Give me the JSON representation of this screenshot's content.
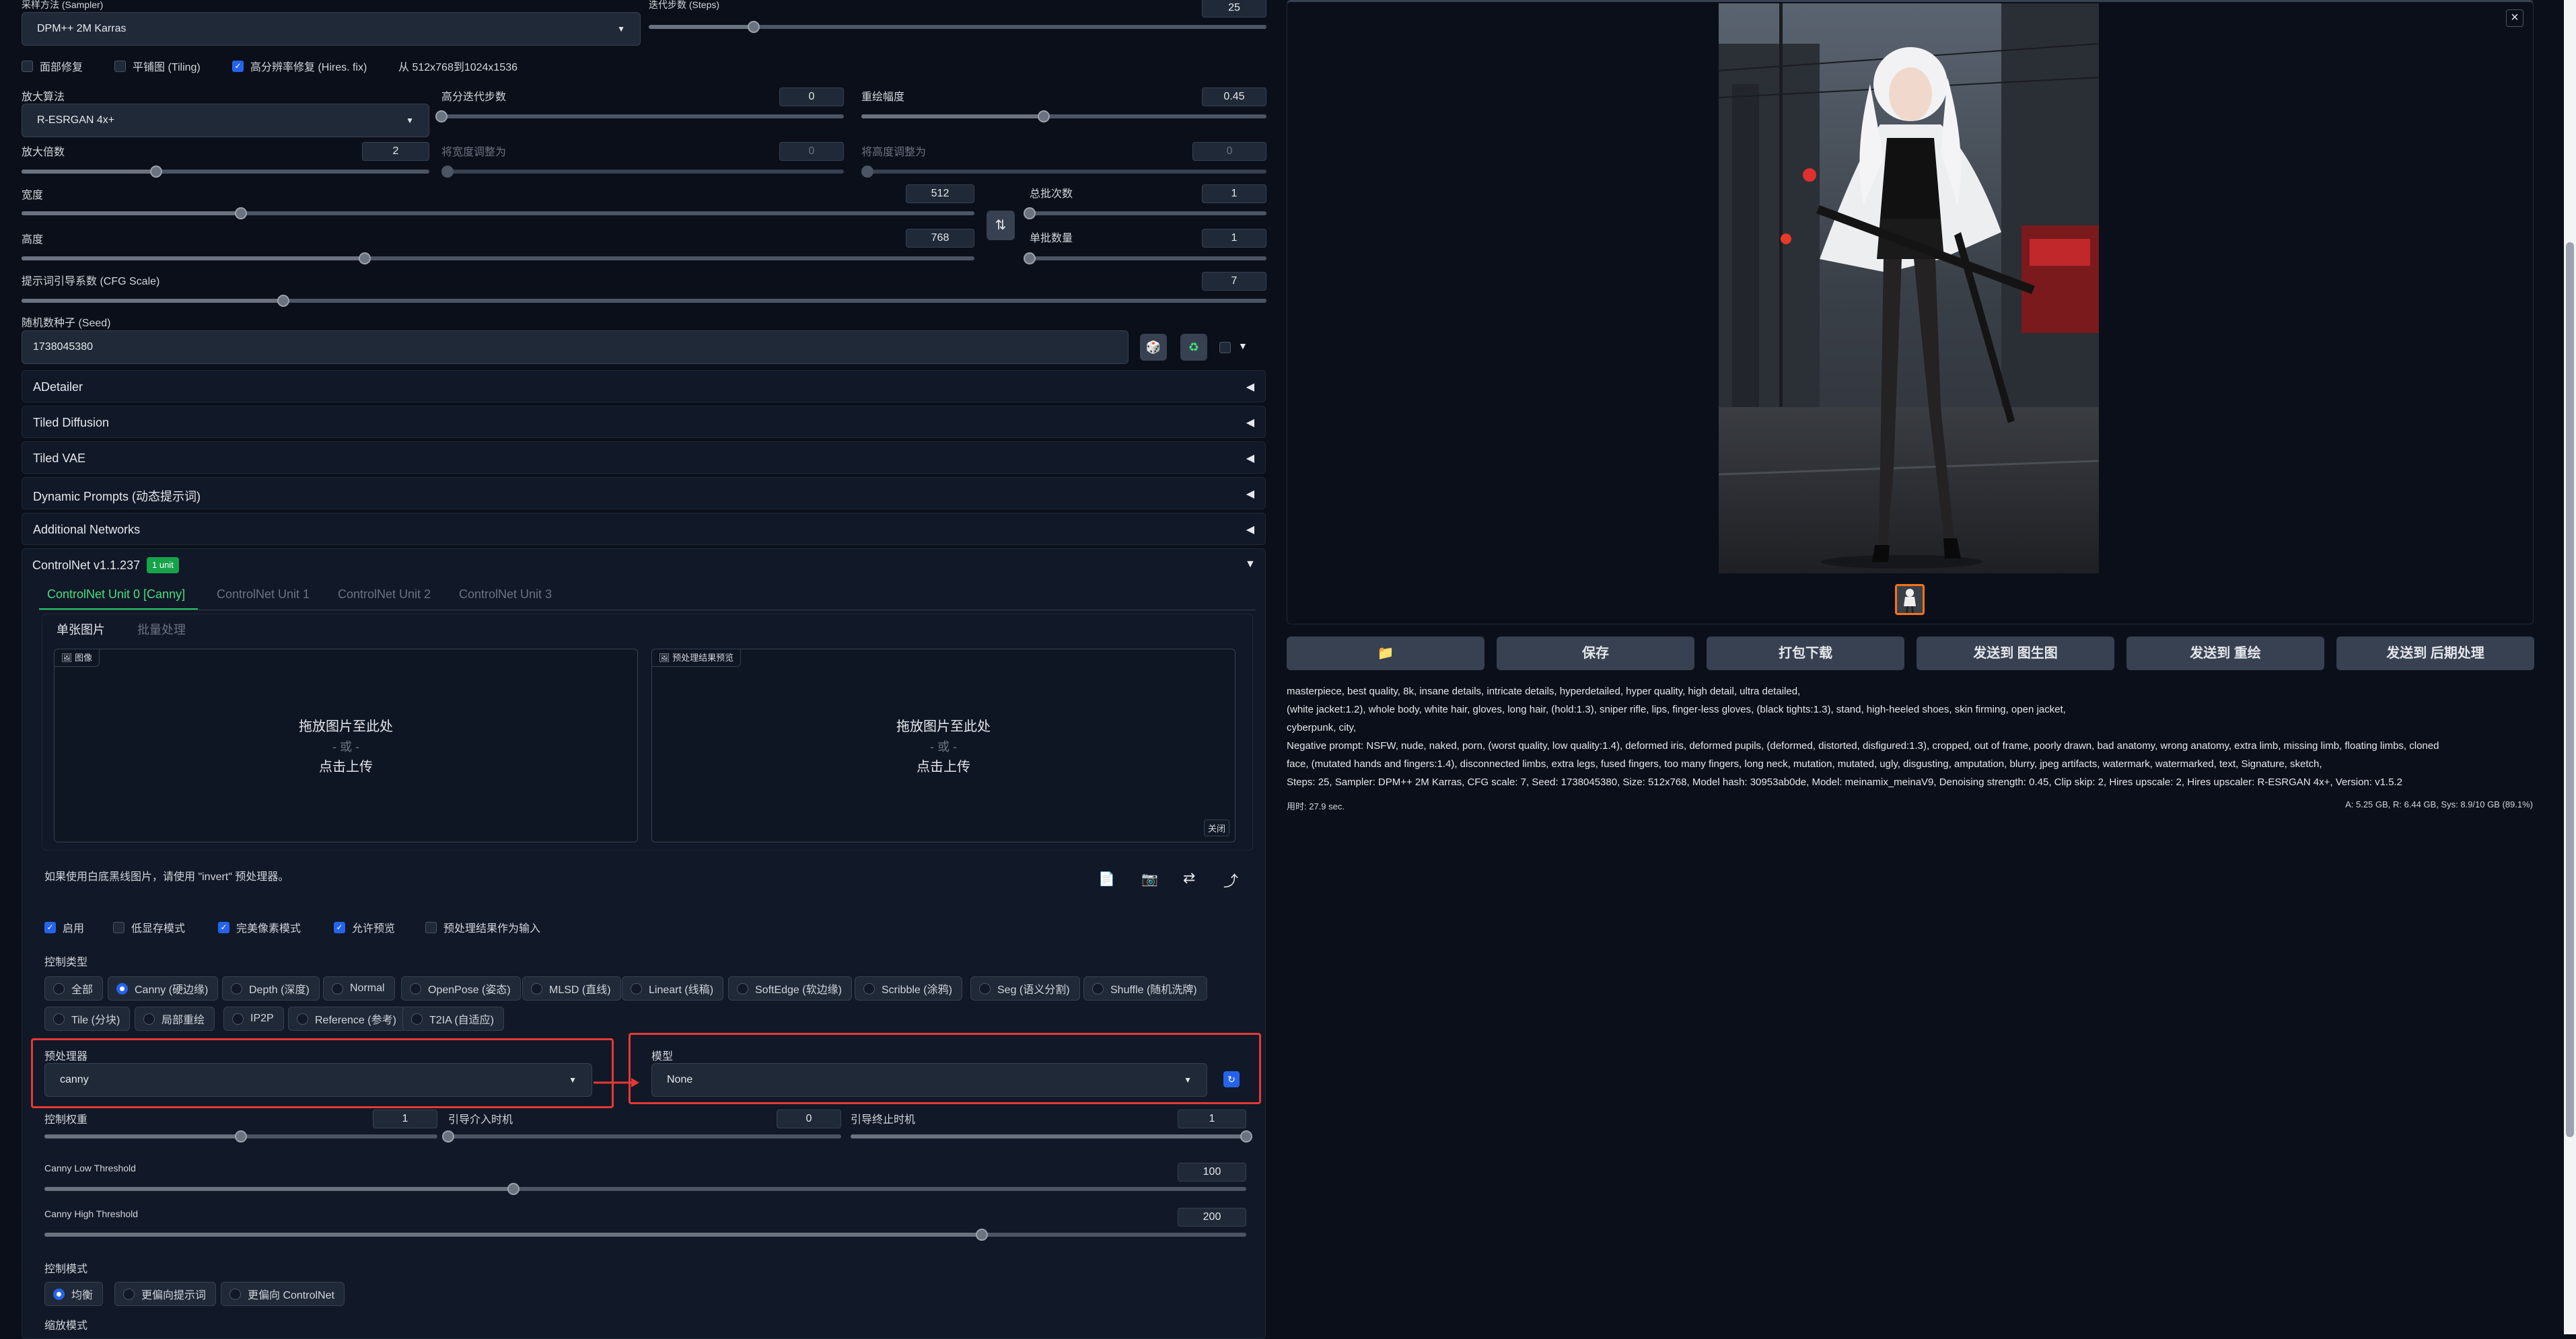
{
  "sampler": {
    "label": "采样方法 (Sampler)",
    "value": "DPM++ 2M Karras"
  },
  "steps": {
    "label": "迭代步数 (Steps)",
    "value": "25",
    "fraction": 0.17
  },
  "checks": {
    "face": "面部修复",
    "tiling": "平铺图 (Tiling)",
    "hires": "高分辨率修复 (Hires. fix)",
    "from_to": "从 512x768到1024x1536"
  },
  "upscaler": {
    "label": "放大算法",
    "value": "R-ESRGAN 4x+"
  },
  "hires_steps": {
    "label": "高分迭代步数",
    "value": "0",
    "fraction": 0
  },
  "denoise": {
    "label": "重绘幅度",
    "value": "0.45",
    "fraction": 0.45
  },
  "scale": {
    "label": "放大倍数",
    "value": "2",
    "fraction": 0.33
  },
  "resize_w": {
    "label": "将宽度调整为",
    "value": "0"
  },
  "resize_h": {
    "label": "将高度调整为",
    "value": "0"
  },
  "width": {
    "label": "宽度",
    "value": "512",
    "fraction": 0.23
  },
  "height": {
    "label": "高度",
    "value": "768",
    "fraction": 0.36
  },
  "batch_count": {
    "label": "总批次数",
    "value": "1",
    "fraction": 0
  },
  "batch_size": {
    "label": "单批数量",
    "value": "1",
    "fraction": 0
  },
  "cfg": {
    "label": "提示词引导系数 (CFG Scale)",
    "value": "7",
    "fraction": 0.21
  },
  "seed": {
    "label": "随机数种子 (Seed)",
    "value": "1738045380"
  },
  "accordions": [
    "ADetailer",
    "Tiled Diffusion",
    "Tiled VAE",
    "Dynamic Prompts (动态提示词)",
    "Additional Networks"
  ],
  "controlnet": {
    "title": "ControlNet v1.1.237",
    "badge": "1 unit",
    "units": [
      "ControlNet Unit 0 [Canny]",
      "ControlNet Unit 1",
      "ControlNet Unit 2",
      "ControlNet Unit 3"
    ],
    "subtabs": [
      "单张图片",
      "批量处理"
    ],
    "image_tag": "图像",
    "preview_tag": "预处理结果预览",
    "drop_text": "拖放图片至此处",
    "drop_or": "- 或 -",
    "drop_click": "点击上传",
    "close": "关闭",
    "invert_hint": "如果使用白底黑线图片，请使用 \"invert\" 预处理器。",
    "options": [
      "启用",
      "低显存模式",
      "完美像素模式",
      "允许预览",
      "预处理结果作为输入"
    ],
    "control_type_label": "控制类型",
    "types": [
      "全部",
      "Canny (硬边缘)",
      "Depth (深度)",
      "Normal",
      "OpenPose (姿态)",
      "MLSD (直线)",
      "Lineart (线稿)",
      "SoftEdge (软边缘)",
      "Scribble (涂鸦)",
      "Seg (语义分割)",
      "Shuffle (随机洗牌)",
      "Tile (分块)",
      "局部重绘",
      "IP2P",
      "Reference (参考)",
      "T2IA (自适应)"
    ],
    "preprocessor": {
      "label": "预处理器",
      "value": "canny"
    },
    "model": {
      "label": "模型",
      "value": "None"
    },
    "weight": {
      "label": "控制权重",
      "value": "1",
      "fraction": 0.5
    },
    "start": {
      "label": "引导介入时机",
      "value": "0",
      "fraction": 0
    },
    "end": {
      "label": "引导终止时机",
      "value": "1",
      "fraction": 1
    },
    "low": {
      "label": "Canny Low Threshold",
      "value": "100",
      "fraction": 0.39
    },
    "high": {
      "label": "Canny High Threshold",
      "value": "200",
      "fraction": 0.78
    },
    "mode_label": "控制模式",
    "modes": [
      "均衡",
      "更偏向提示词",
      "更偏向 ControlNet"
    ],
    "resize_label": "缩放模式"
  },
  "buttons": {
    "folder": "📁",
    "save": "保存",
    "zip": "打包下载",
    "to_img2img": "发送到 图生图",
    "to_inpaint": "发送到 重绘",
    "to_extras": "发送到 后期处理"
  },
  "info": {
    "l1": "masterpiece, best quality, 8k, insane details, intricate details, hyperdetailed, hyper quality, high detail, ultra detailed,",
    "l2": "(white jacket:1.2), whole body, white hair, gloves, long hair, (hold:1.3), sniper rifle, lips, finger-less gloves, (black tights:1.3), stand, high-heeled shoes, skin firming, open jacket,",
    "l3": "cyberpunk, city,",
    "l4": "Negative prompt: NSFW, nude, naked, porn, (worst quality, low quality:1.4), deformed iris, deformed pupils, (deformed, distorted, disfigured:1.3), cropped, out of frame, poorly drawn, bad anatomy, wrong anatomy, extra limb, missing limb, floating limbs, cloned",
    "l5": "face, (mutated hands and fingers:1.4), disconnected limbs, extra legs, fused fingers, too many fingers, long neck, mutation, mutated, ugly, disgusting, amputation, blurry, jpeg artifacts, watermark, watermarked, text, Signature, sketch,",
    "l6": "Steps: 25, Sampler: DPM++ 2M Karras, CFG scale: 7, Seed: 1738045380, Size: 512x768, Model hash: 30953ab0de, Model: meinamix_meinaV9, Denoising strength: 0.45, Clip skip: 2, Hires upscale: 2, Hires upscaler: R-ESRGAN 4x+, Version: v1.5.2",
    "time": "用时: 27.9 sec.",
    "mem": "A: 5.25 GB, R: 6.44 GB, Sys: 8.9/10 GB (89.1%)"
  },
  "gallery": {
    "close": "×"
  }
}
